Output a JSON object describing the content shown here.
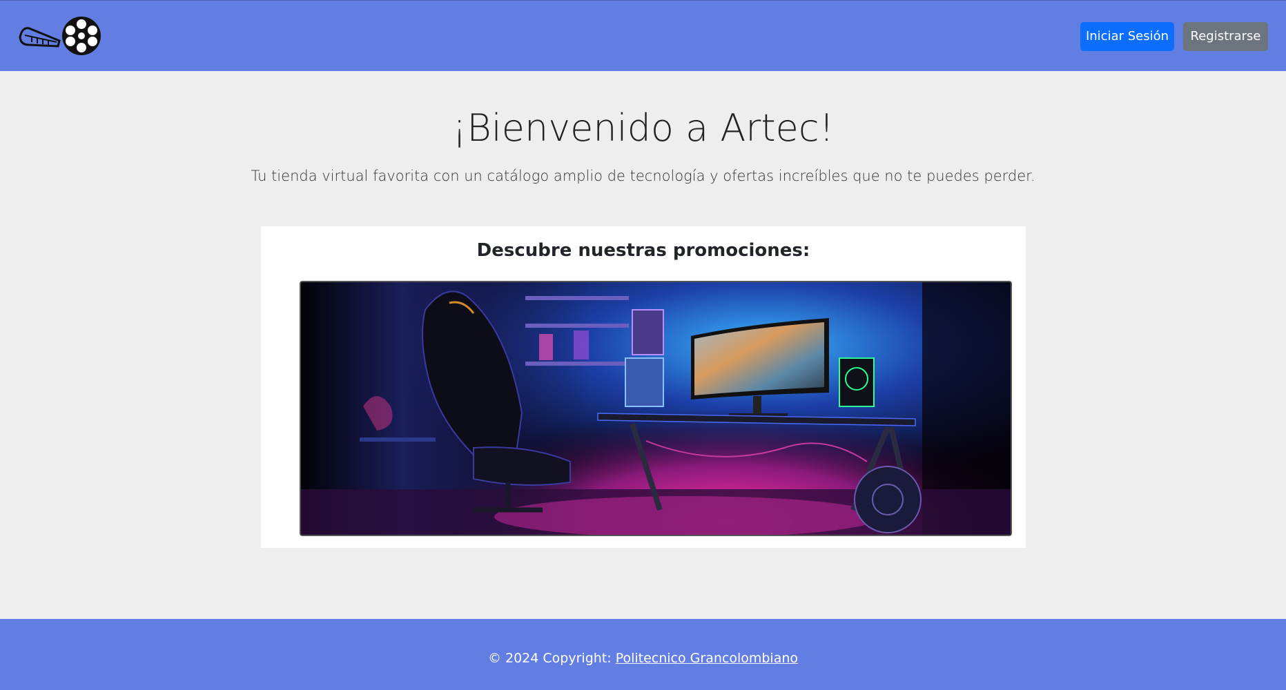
{
  "header": {
    "logo_icon": "film-reel-icon",
    "login_label": "Iniciar Sesión",
    "register_label": "Registrarse"
  },
  "hero": {
    "title": "¡Bienvenido a Artec!",
    "subtitle": "Tu tienda virtual favorita con un catálogo amplio de tecnología y ofertas increíbles que no te puedes perder."
  },
  "promo": {
    "title": "Descubre nuestras promociones:",
    "image_icon": "gaming-setup-image"
  },
  "footer": {
    "copyright": "© 2024 Copyright: ",
    "link_label": "Politecnico Grancolombiano"
  },
  "colors": {
    "nav_bg": "#637ee2",
    "primary_button": "#0d6efd",
    "secondary_button": "#6c757d",
    "page_bg": "#eeeeee"
  }
}
